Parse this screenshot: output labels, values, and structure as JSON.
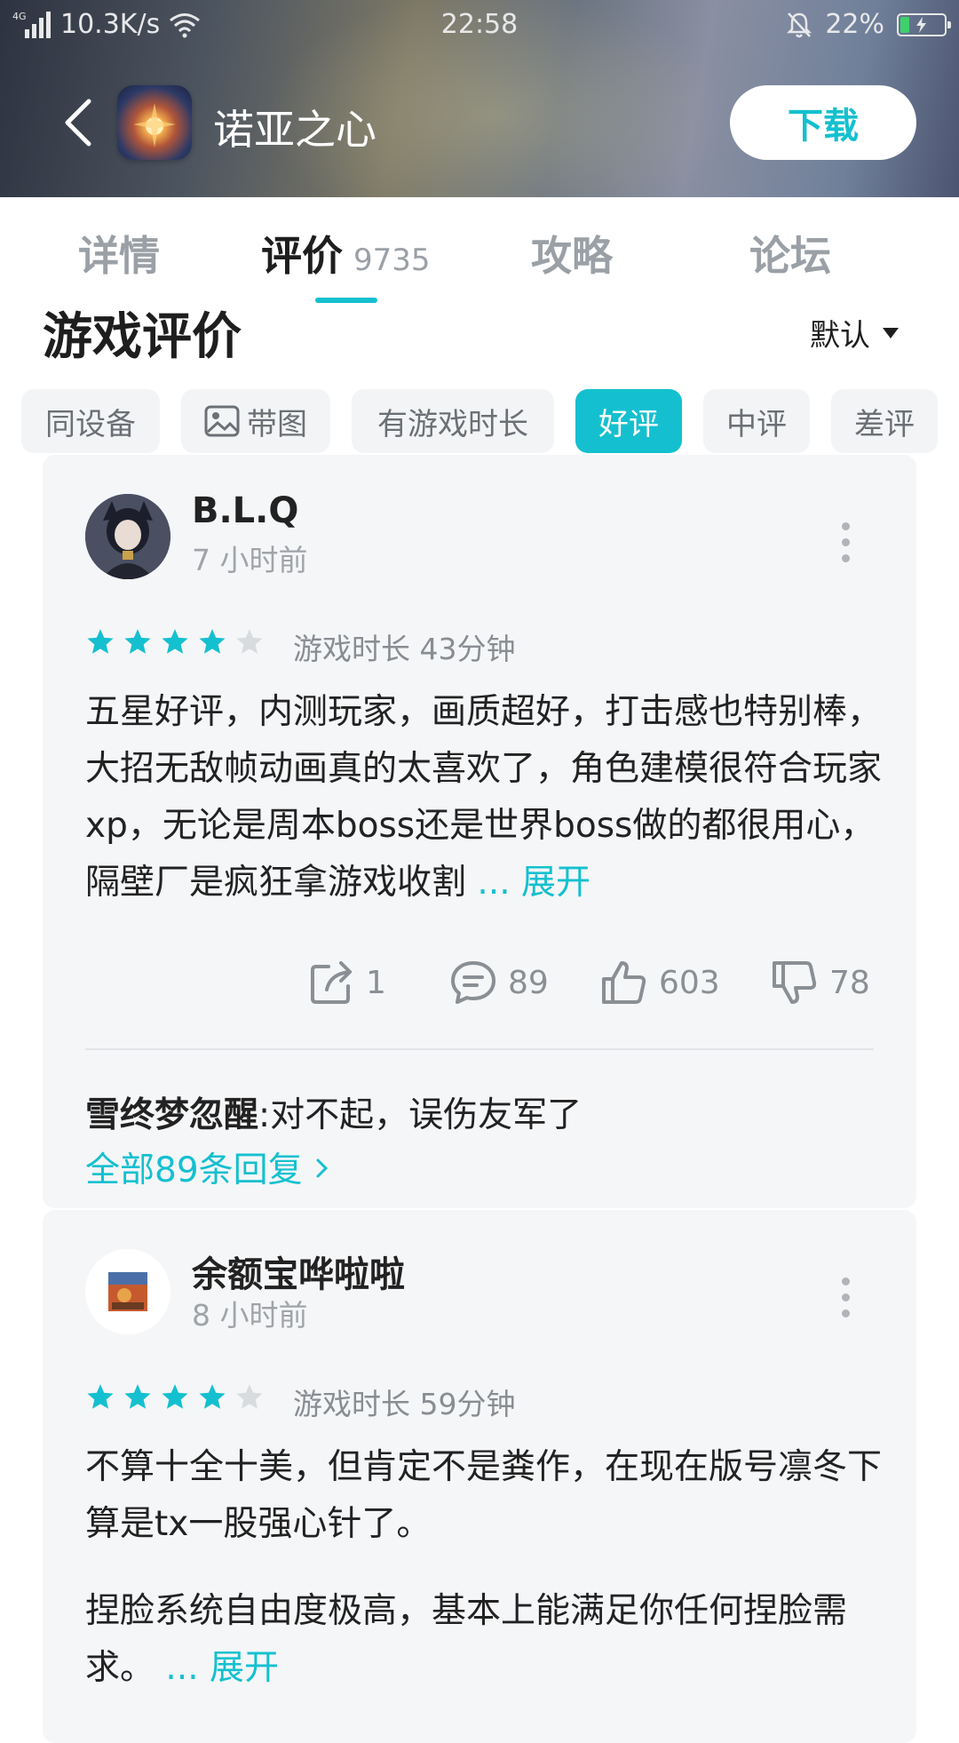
{
  "status_bar": {
    "network": "4G",
    "speed": "10.3K/s",
    "time": "22:58",
    "battery": "22%"
  },
  "app_bar": {
    "title": "诺亚之心",
    "download_label": "下载"
  },
  "tabs": [
    {
      "label": "详情"
    },
    {
      "label": "评价",
      "count": "9735",
      "active": true
    },
    {
      "label": "攻略"
    },
    {
      "label": "论坛"
    }
  ],
  "section": {
    "title": "游戏评价",
    "sort_label": "默认"
  },
  "filters": [
    {
      "label": "同设备"
    },
    {
      "label": "带图",
      "icon": "image-icon"
    },
    {
      "label": "有游戏时长"
    },
    {
      "label": "好评",
      "active": true
    },
    {
      "label": "中评"
    },
    {
      "label": "差评"
    }
  ],
  "reviews": [
    {
      "user": "B.L.Q",
      "time": "7 小时前",
      "rating": 4,
      "playtime": "游戏时长 43分钟",
      "text": "五星好评，内测玩家，画质超好，打击感也特别棒，大招无敌帧动画真的太喜欢了，角色建模很符合玩家xp，无论是周本boss还是世界boss做的都很用心，隔壁厂是疯狂拿游戏收割",
      "expand": "... 展开",
      "shares": "1",
      "comments": "89",
      "likes": "603",
      "dislikes": "78",
      "top_reply_user": "雪终梦忽醒",
      "top_reply_sep": ":",
      "top_reply_text": "对不起，误伤友军了",
      "all_replies": "全部89条回复"
    },
    {
      "user": "余额宝哗啦啦",
      "time": "8 小时前",
      "rating": 4,
      "playtime": "游戏时长 59分钟",
      "text_p1": "不算十全十美，但肯定不是粪作，在现在版号凛冬下算是tx一股强心针了。",
      "text_p2": "捏脸系统自由度极高，基本上能满足你任何捏脸需求。",
      "expand": "... 展开"
    }
  ],
  "colors": {
    "accent": "#14c0cf",
    "card_bg": "#f5f6f8",
    "star_off": "#d9dcdf"
  }
}
